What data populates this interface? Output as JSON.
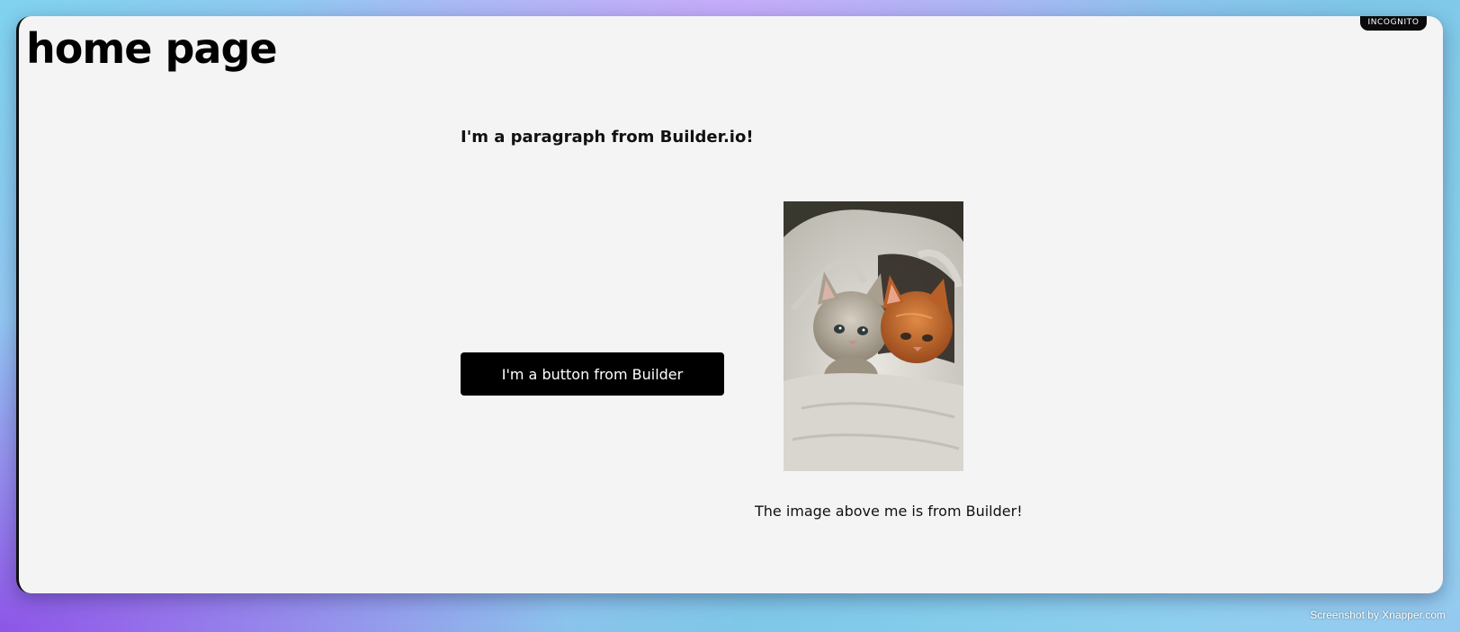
{
  "badge": {
    "incognito": "INCOGNITO"
  },
  "page": {
    "title": "home page",
    "paragraph": "I'm a paragraph from Builder.io!",
    "button_label": "I'm a button from Builder",
    "image_caption": "The image above me is from Builder!"
  },
  "watermark": "Screenshot by Xnapper.com",
  "colors": {
    "page_background": "#f4f4f5",
    "button_background": "#000000",
    "button_text": "#ffffff",
    "badge_background": "#0a0a0a"
  }
}
